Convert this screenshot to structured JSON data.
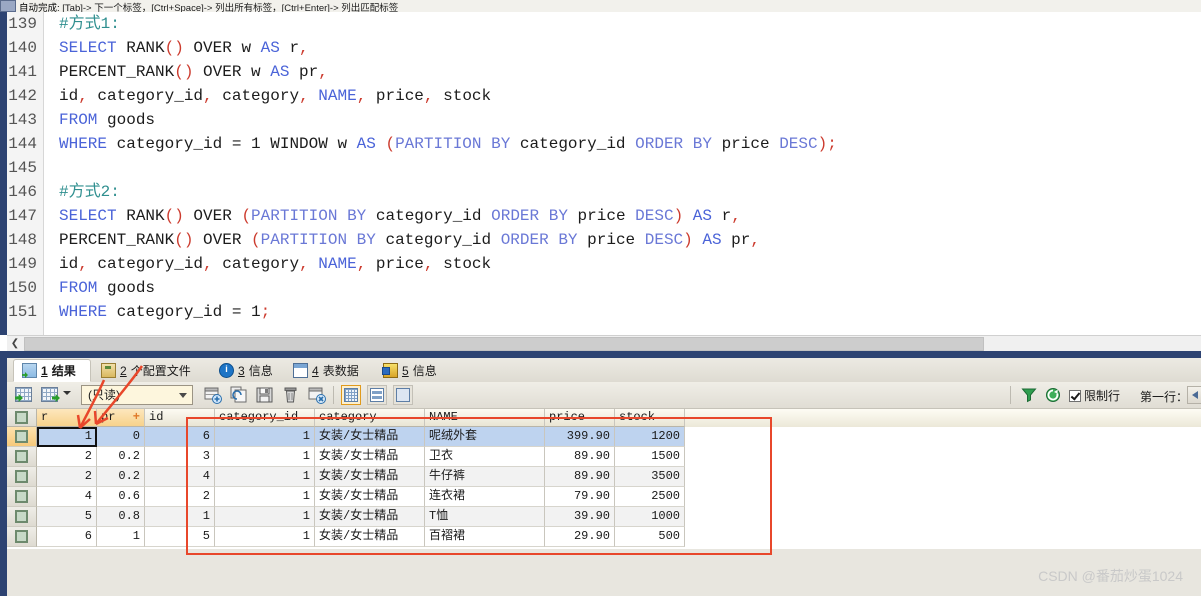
{
  "hintbar": {
    "label": "自动完成:",
    "text": "[Tab]-> 下一个标签，[Ctrl+Space]-> 列出所有标签，[Ctrl+Enter]-> 列出匹配标签"
  },
  "editor": {
    "lines": [
      {
        "no": "139",
        "tokens": [
          {
            "t": "#方式1:",
            "c": "com"
          }
        ]
      },
      {
        "no": "140",
        "tokens": [
          {
            "t": "SELECT",
            "c": "kw"
          },
          {
            "t": " RANK",
            "c": "fn"
          },
          {
            "t": "()",
            "c": "paren"
          },
          {
            "t": " OVER w ",
            "c": "fn"
          },
          {
            "t": "AS",
            "c": "kw"
          },
          {
            "t": " r",
            "c": "fn"
          },
          {
            "t": ",",
            "c": "punc"
          }
        ]
      },
      {
        "no": "141",
        "tokens": [
          {
            "t": "PERCENT_RANK",
            "c": "fn"
          },
          {
            "t": "()",
            "c": "paren"
          },
          {
            "t": " OVER w ",
            "c": "fn"
          },
          {
            "t": "AS",
            "c": "kw"
          },
          {
            "t": " pr",
            "c": "fn"
          },
          {
            "t": ",",
            "c": "punc"
          }
        ]
      },
      {
        "no": "142",
        "tokens": [
          {
            "t": "id",
            "c": "fn"
          },
          {
            "t": ",",
            "c": "punc"
          },
          {
            "t": " category_id",
            "c": "fn"
          },
          {
            "t": ",",
            "c": "punc"
          },
          {
            "t": " category",
            "c": "fn"
          },
          {
            "t": ",",
            "c": "punc"
          },
          {
            "t": " ",
            "c": "fn"
          },
          {
            "t": "NAME",
            "c": "kw"
          },
          {
            "t": ",",
            "c": "punc"
          },
          {
            "t": " price",
            "c": "fn"
          },
          {
            "t": ",",
            "c": "punc"
          },
          {
            "t": " stock",
            "c": "fn"
          }
        ]
      },
      {
        "no": "143",
        "tokens": [
          {
            "t": "FROM",
            "c": "kw"
          },
          {
            "t": " goods",
            "c": "fn"
          }
        ]
      },
      {
        "no": "144",
        "tokens": [
          {
            "t": "WHERE",
            "c": "kw"
          },
          {
            "t": " category_id = 1 WINDOW w ",
            "c": "fn"
          },
          {
            "t": "AS",
            "c": "kw"
          },
          {
            "t": " ",
            "c": "fn"
          },
          {
            "t": "(",
            "c": "paren"
          },
          {
            "t": "PARTITION",
            "c": "pbl"
          },
          {
            "t": " ",
            "c": "fn"
          },
          {
            "t": "BY",
            "c": "pbl"
          },
          {
            "t": " category_id ",
            "c": "fn"
          },
          {
            "t": "ORDER",
            "c": "pbl"
          },
          {
            "t": " ",
            "c": "fn"
          },
          {
            "t": "BY",
            "c": "pbl"
          },
          {
            "t": " price ",
            "c": "fn"
          },
          {
            "t": "DESC",
            "c": "pbl"
          },
          {
            "t": ")",
            "c": "paren"
          },
          {
            "t": ";",
            "c": "punc"
          }
        ]
      },
      {
        "no": "145",
        "tokens": []
      },
      {
        "no": "146",
        "tokens": [
          {
            "t": "#方式2:",
            "c": "com"
          }
        ]
      },
      {
        "no": "147",
        "tokens": [
          {
            "t": "SELECT",
            "c": "kw"
          },
          {
            "t": " RANK",
            "c": "fn"
          },
          {
            "t": "()",
            "c": "paren"
          },
          {
            "t": " OVER ",
            "c": "fn"
          },
          {
            "t": "(",
            "c": "paren"
          },
          {
            "t": "PARTITION",
            "c": "pbl"
          },
          {
            "t": " ",
            "c": "fn"
          },
          {
            "t": "BY",
            "c": "pbl"
          },
          {
            "t": " category_id ",
            "c": "fn"
          },
          {
            "t": "ORDER",
            "c": "pbl"
          },
          {
            "t": " ",
            "c": "fn"
          },
          {
            "t": "BY",
            "c": "pbl"
          },
          {
            "t": " price ",
            "c": "fn"
          },
          {
            "t": "DESC",
            "c": "pbl"
          },
          {
            "t": ")",
            "c": "paren"
          },
          {
            "t": " ",
            "c": "fn"
          },
          {
            "t": "AS",
            "c": "kw"
          },
          {
            "t": " r",
            "c": "fn"
          },
          {
            "t": ",",
            "c": "punc"
          }
        ]
      },
      {
        "no": "148",
        "tokens": [
          {
            "t": "PERCENT_RANK",
            "c": "fn"
          },
          {
            "t": "()",
            "c": "paren"
          },
          {
            "t": " OVER ",
            "c": "fn"
          },
          {
            "t": "(",
            "c": "paren"
          },
          {
            "t": "PARTITION",
            "c": "pbl"
          },
          {
            "t": " ",
            "c": "fn"
          },
          {
            "t": "BY",
            "c": "pbl"
          },
          {
            "t": " category_id ",
            "c": "fn"
          },
          {
            "t": "ORDER",
            "c": "pbl"
          },
          {
            "t": " ",
            "c": "fn"
          },
          {
            "t": "BY",
            "c": "pbl"
          },
          {
            "t": " price ",
            "c": "fn"
          },
          {
            "t": "DESC",
            "c": "pbl"
          },
          {
            "t": ")",
            "c": "paren"
          },
          {
            "t": " ",
            "c": "fn"
          },
          {
            "t": "AS",
            "c": "kw"
          },
          {
            "t": " pr",
            "c": "fn"
          },
          {
            "t": ",",
            "c": "punc"
          }
        ]
      },
      {
        "no": "149",
        "tokens": [
          {
            "t": "id",
            "c": "fn"
          },
          {
            "t": ",",
            "c": "punc"
          },
          {
            "t": " category_id",
            "c": "fn"
          },
          {
            "t": ",",
            "c": "punc"
          },
          {
            "t": " category",
            "c": "fn"
          },
          {
            "t": ",",
            "c": "punc"
          },
          {
            "t": " ",
            "c": "fn"
          },
          {
            "t": "NAME",
            "c": "kw"
          },
          {
            "t": ",",
            "c": "punc"
          },
          {
            "t": " price",
            "c": "fn"
          },
          {
            "t": ",",
            "c": "punc"
          },
          {
            "t": " stock",
            "c": "fn"
          }
        ]
      },
      {
        "no": "150",
        "tokens": [
          {
            "t": "FROM",
            "c": "kw"
          },
          {
            "t": " goods",
            "c": "fn"
          }
        ]
      },
      {
        "no": "151",
        "tokens": [
          {
            "t": "WHERE",
            "c": "kw"
          },
          {
            "t": " category_id = 1",
            "c": "fn"
          },
          {
            "t": ";",
            "c": "punc"
          }
        ]
      }
    ]
  },
  "tabs": [
    {
      "num": "1",
      "label": "结果",
      "icon": "result-grid-icon",
      "active": true
    },
    {
      "num": "2",
      "label": "个配置文件",
      "icon": "profile-icon",
      "active": false
    },
    {
      "num": "3",
      "label": "信息",
      "icon": "info-icon",
      "active": false
    },
    {
      "num": "4",
      "label": "表数据",
      "icon": "table-data-icon",
      "active": false
    },
    {
      "num": "5",
      "label": "信息",
      "icon": "info-alt-icon",
      "active": false
    }
  ],
  "toolbar": {
    "combo_value": "(只读)",
    "limit_rows_label": "限制行",
    "first_row_label": "第一行：",
    "buttons": [
      {
        "name": "apply-changes-button",
        "icon": "grid-green-arrow-icon"
      },
      {
        "name": "export-grid-button",
        "icon": "grid-export-icon"
      },
      {
        "name": "insert-record-button",
        "icon": "record-add-icon"
      },
      {
        "name": "duplicate-record-button",
        "icon": "record-duplicate-icon"
      },
      {
        "name": "save-record-button",
        "icon": "floppy-save-icon"
      },
      {
        "name": "delete-record-button",
        "icon": "trash-delete-icon"
      },
      {
        "name": "cancel-changes-button",
        "icon": "record-cancel-icon"
      }
    ],
    "view_modes": [
      {
        "name": "grid-view-button",
        "icon": "grid-view-icon",
        "selected": true
      },
      {
        "name": "form-view-button",
        "icon": "form-view-icon",
        "selected": false
      },
      {
        "name": "text-view-button",
        "icon": "text-view-icon",
        "selected": false
      }
    ],
    "filter_icon": "funnel-filter-icon",
    "refresh_icon": "refresh-icon",
    "spinner_icon": "spinner-left-arrow-icon"
  },
  "grid": {
    "columns": [
      "r",
      "pr",
      "id",
      "category_id",
      "category",
      "NAME",
      "price",
      "stock"
    ],
    "pr_marker": "+",
    "rows": [
      {
        "r": "1",
        "pr": "0",
        "id": "6",
        "category_id": "1",
        "category": "女装/女士精品",
        "NAME": "呢绒外套",
        "price": "399.90",
        "stock": "1200"
      },
      {
        "r": "2",
        "pr": "0.2",
        "id": "3",
        "category_id": "1",
        "category": "女装/女士精品",
        "NAME": "卫衣",
        "price": "89.90",
        "stock": "1500"
      },
      {
        "r": "2",
        "pr": "0.2",
        "id": "4",
        "category_id": "1",
        "category": "女装/女士精品",
        "NAME": "牛仔裤",
        "price": "89.90",
        "stock": "3500"
      },
      {
        "r": "4",
        "pr": "0.6",
        "id": "2",
        "category_id": "1",
        "category": "女装/女士精品",
        "NAME": "连衣裙",
        "price": "79.90",
        "stock": "2500"
      },
      {
        "r": "5",
        "pr": "0.8",
        "id": "1",
        "category_id": "1",
        "category": "女装/女士精品",
        "NAME": "T恤",
        "price": "39.90",
        "stock": "1000"
      },
      {
        "r": "6",
        "pr": "1",
        "id": "5",
        "category_id": "1",
        "category": "女装/女士精品",
        "NAME": "百褶裙",
        "price": "29.90",
        "stock": "500"
      }
    ]
  },
  "watermark": "CSDN @番茄炒蛋1024",
  "colors": {
    "frame_blue": "#2d4372",
    "annotation_red": "#e8472b",
    "selection_blue": "#bed3ef",
    "highlight_gold": "#f7d28b"
  }
}
